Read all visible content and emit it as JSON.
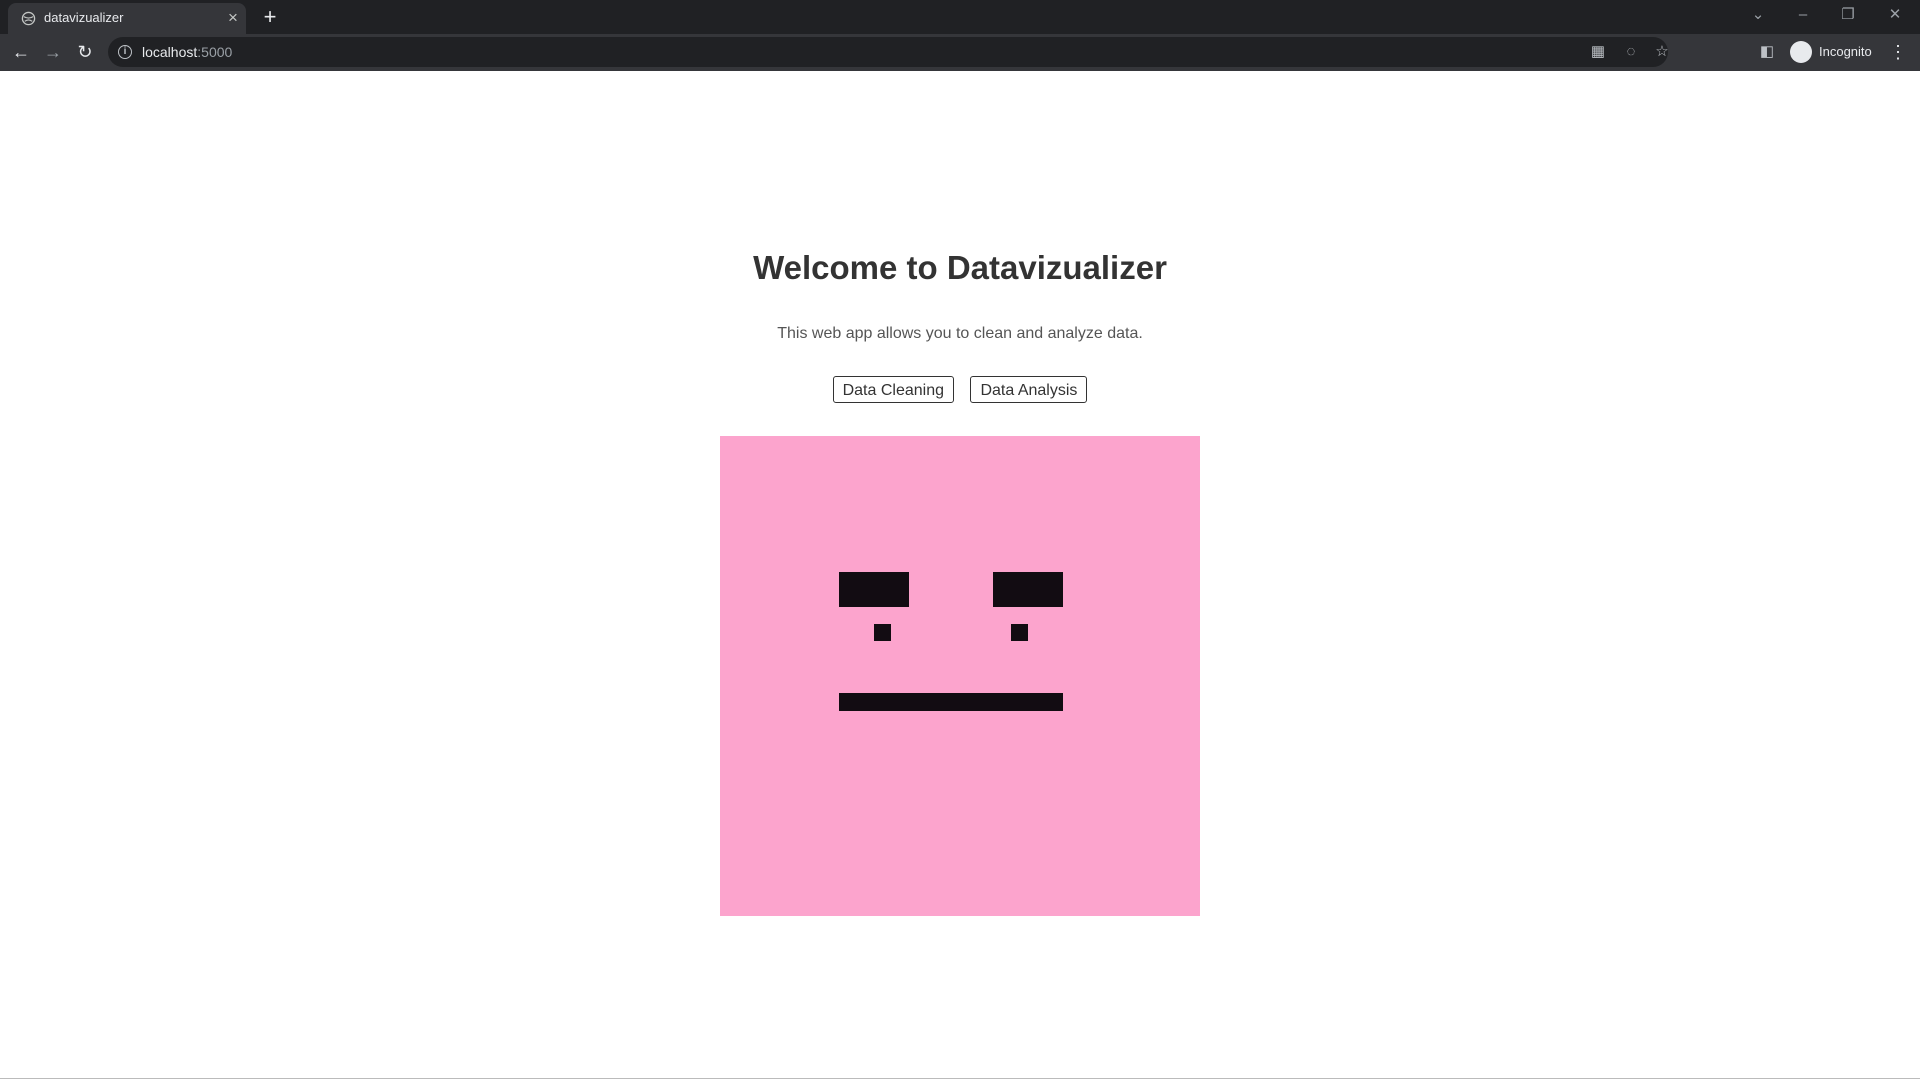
{
  "browser": {
    "tab_title": "datavizualizer",
    "url_host": "localhost",
    "url_port": ":5000",
    "profile_label": "Incognito"
  },
  "page": {
    "title": "Welcome to Datavizualizer",
    "subtitle": "This web app allows you to clean and analyze data.",
    "buttons": {
      "cleaning": "Data Cleaning",
      "analysis": "Data Analysis"
    },
    "image": {
      "description_icon": "neutral-face-icon",
      "background_color": "#fca4cd",
      "feature_color": "#120c12"
    }
  }
}
